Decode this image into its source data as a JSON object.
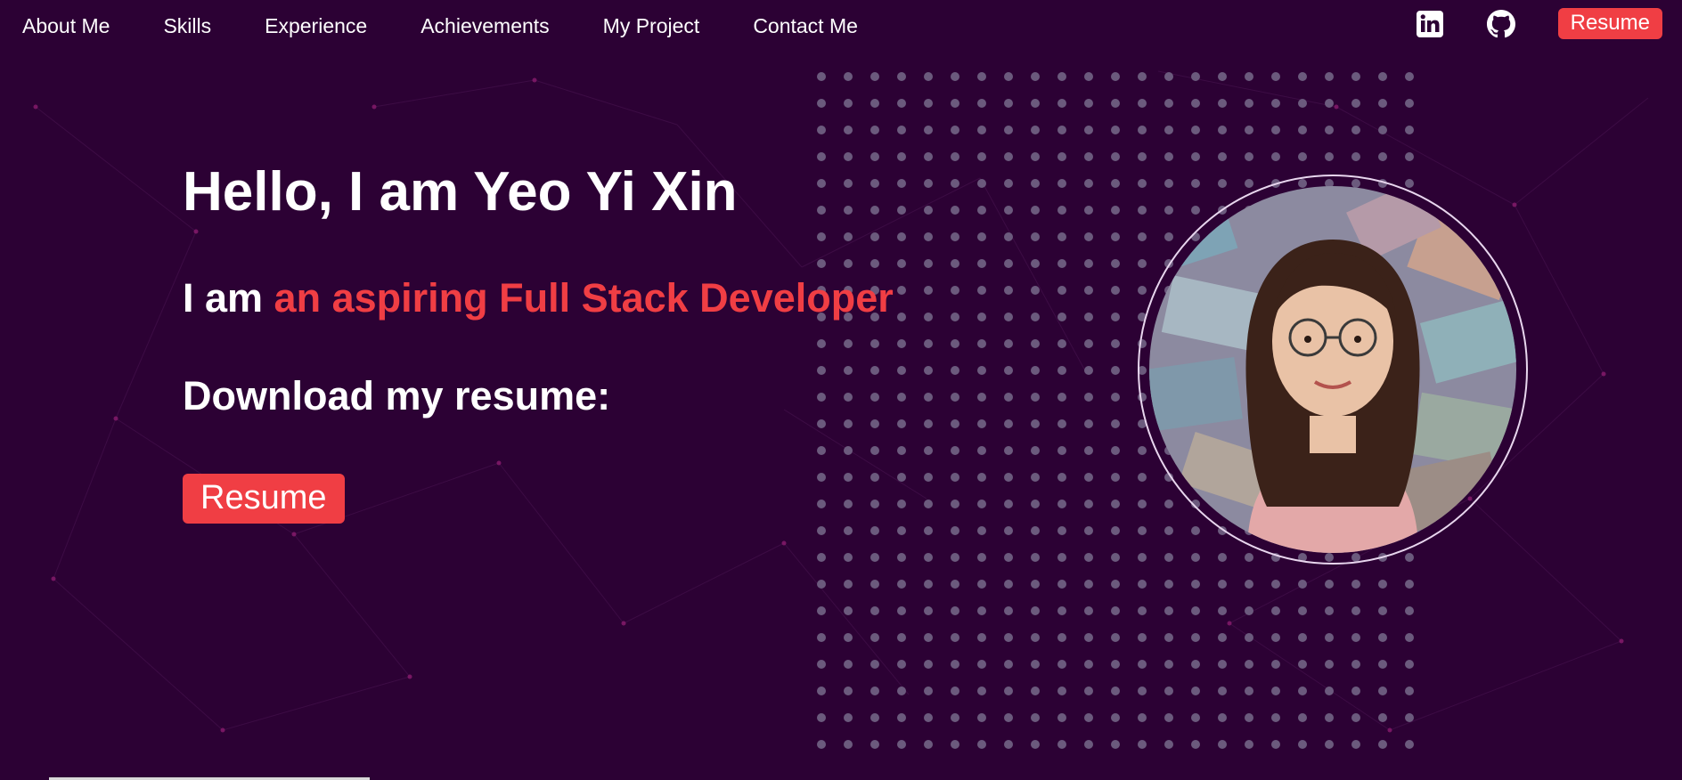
{
  "nav": {
    "links": [
      {
        "label": "About Me"
      },
      {
        "label": "Skills"
      },
      {
        "label": "Experience"
      },
      {
        "label": "Achievements"
      },
      {
        "label": "My Project"
      },
      {
        "label": "Contact Me"
      }
    ],
    "icons": {
      "linkedin": "linkedin-icon",
      "github": "github-icon"
    },
    "resume_label": "Resume"
  },
  "hero": {
    "title": "Hello, I am Yeo Yi Xin",
    "sub_prefix": "I am ",
    "sub_accent": "an aspiring Full Stack Developer",
    "download_text": "Download my resume:",
    "resume_button": "Resume"
  },
  "colors": {
    "background": "#2c0134",
    "accent": "#f03e44",
    "dots": "#6b5a7d",
    "text": "#ffffff"
  }
}
